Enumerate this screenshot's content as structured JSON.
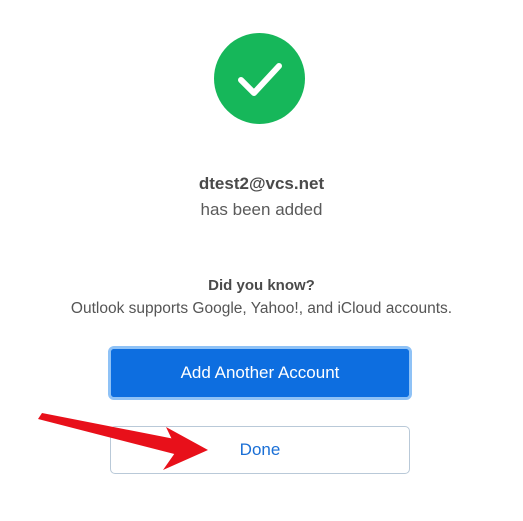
{
  "success_icon": "checkmark-icon",
  "colors": {
    "success_green": "#16b75a",
    "primary_blue": "#0a72e3",
    "link_blue": "#1a6fd6",
    "annotation_red": "#e8101a"
  },
  "account": {
    "email": "dtest2@vcs.net",
    "status": "has been added"
  },
  "tip": {
    "heading": "Did you know?",
    "text": "Outlook supports Google, Yahoo!, and iCloud accounts."
  },
  "buttons": {
    "add_another": "Add Another Account",
    "done": "Done"
  }
}
